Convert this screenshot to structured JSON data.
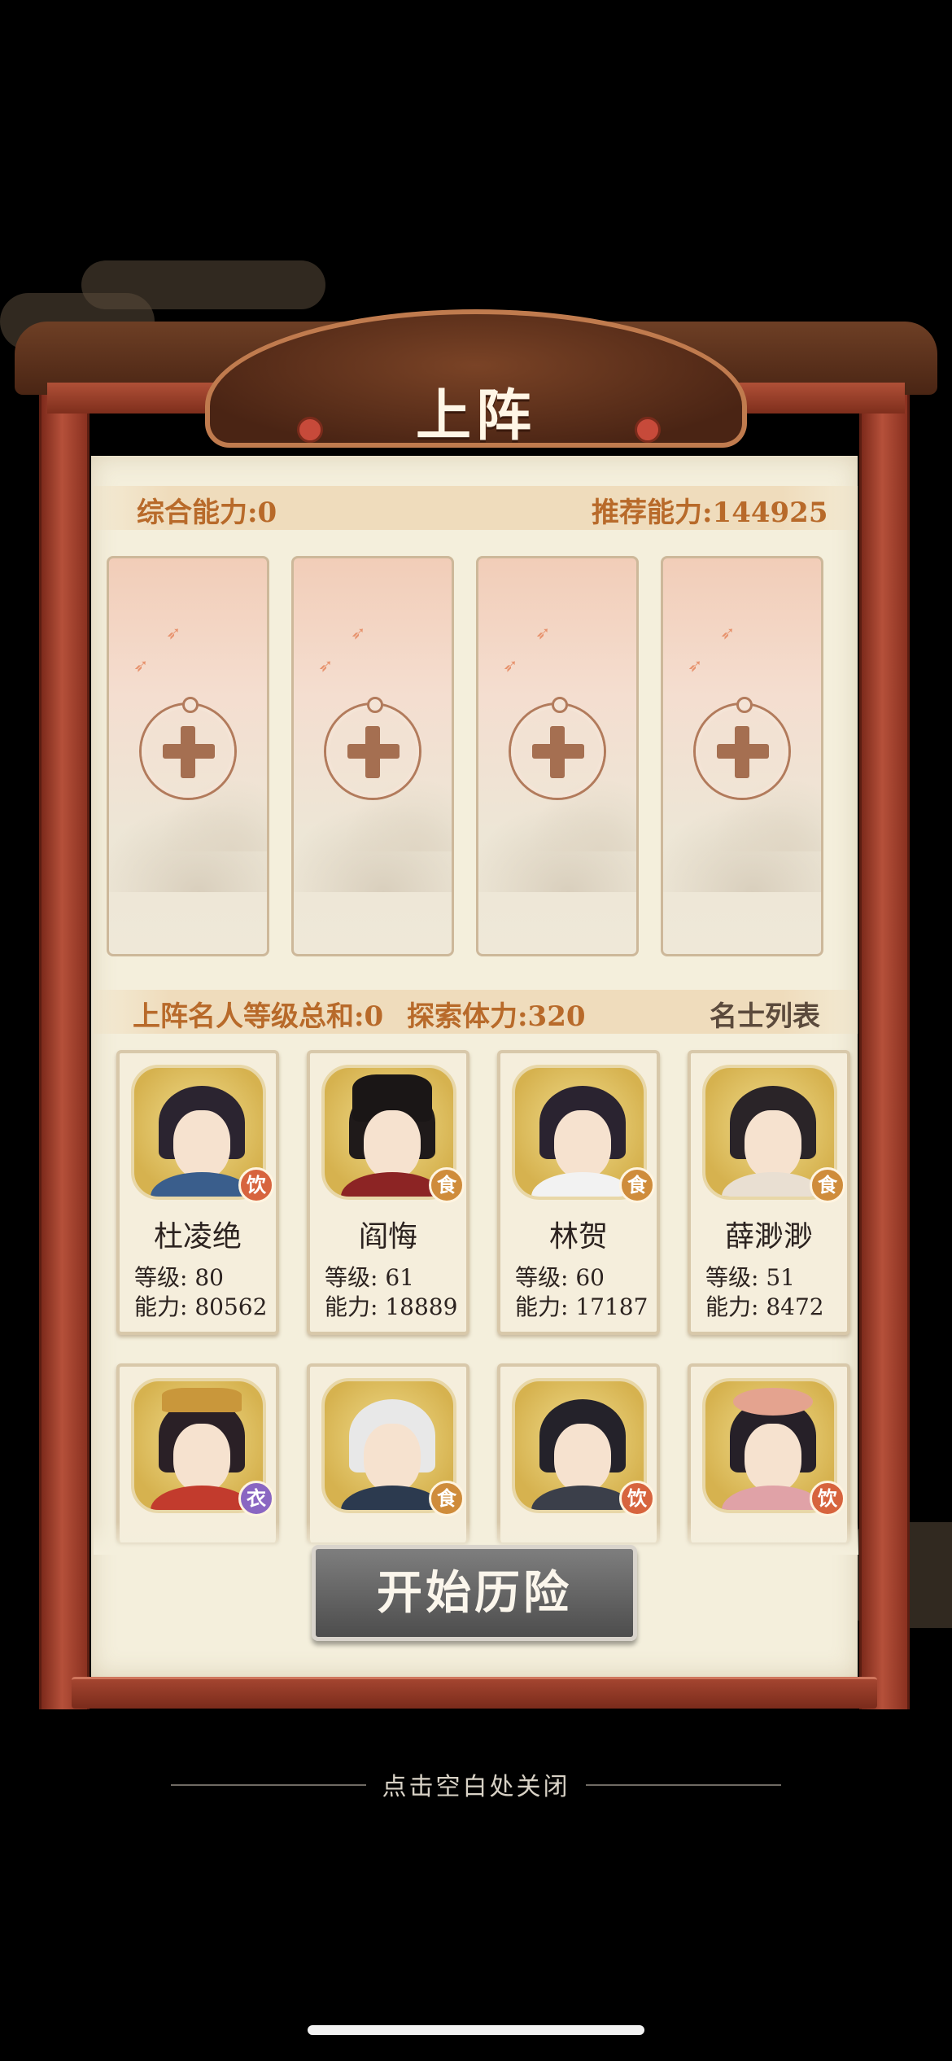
{
  "title": "上阵",
  "summary": {
    "total_power_label": "综合能力:0",
    "recommended_power_label": "推荐能力:144925"
  },
  "lineup": {
    "level_sum_label": "上阵名人等级总和:0",
    "stamina_label": "探索体力:320",
    "list_title": "名士列表"
  },
  "heroes": [
    {
      "name": "杜凌绝",
      "tag": "饮",
      "tag_type": "drink",
      "level": "等级: 80",
      "power": "能力: 80562",
      "hair_color": "#2b2430",
      "robe_color": "#3a5e8c"
    },
    {
      "name": "阎悔",
      "tag": "食",
      "tag_type": "food",
      "level": "等级: 61",
      "power": "能力: 18889",
      "hair_color": "#1f1a1a",
      "robe_color": "#8c2424"
    },
    {
      "name": "林贺",
      "tag": "食",
      "tag_type": "food",
      "level": "等级: 60",
      "power": "能力: 17187",
      "hair_color": "#2a2330",
      "robe_color": "#f2f2f2"
    },
    {
      "name": "薛渺渺",
      "tag": "食",
      "tag_type": "food",
      "level": "等级: 51",
      "power": "能力: 8472",
      "hair_color": "#2a2428",
      "robe_color": "#e9dfd2"
    },
    {
      "tag": "衣",
      "tag_type": "cloth",
      "hair_color": "#2a2026",
      "robe_color": "#c23b2d"
    },
    {
      "tag": "食",
      "tag_type": "food",
      "hair_color": "#e8e8e8",
      "robe_color": "#2c3a4f"
    },
    {
      "tag": "饮",
      "tag_type": "drink",
      "hair_color": "#24222a",
      "robe_color": "#3b3f4a"
    },
    {
      "tag": "饮",
      "tag_type": "drink",
      "hair_color": "#262028",
      "robe_color": "#e0a2a7"
    }
  ],
  "start_button": "开始历险",
  "close_hint": "点击空白处关闭"
}
